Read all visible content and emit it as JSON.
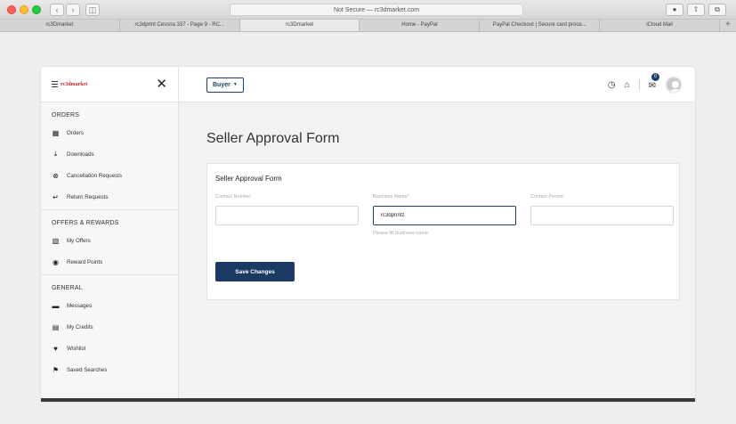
{
  "browser": {
    "address": "Not Secure — rc3dmarket.com",
    "tabs": [
      "rc3Dmarket",
      "rc3dprint Cessna 337 - Page 9 - RC...",
      "rc3Dmarket",
      "Home - PayPal",
      "PayPal Checkout | Secure card proce...",
      "iCloud Mail"
    ],
    "active_tab": 2
  },
  "sidebar": {
    "logo_text": "rc3dmarket",
    "sections": [
      {
        "title": "ORDERS",
        "items": [
          {
            "label": "Orders",
            "icon": "orders-icon"
          },
          {
            "label": "Downloads",
            "icon": "download-icon"
          },
          {
            "label": "Cancellation Requests",
            "icon": "cancel-circle-icon"
          },
          {
            "label": "Return Requests",
            "icon": "return-arrow-icon"
          }
        ]
      },
      {
        "title": "OFFERS & REWARDS",
        "items": [
          {
            "label": "My Offers",
            "icon": "offer-tag-icon"
          },
          {
            "label": "Reward Points",
            "icon": "medal-icon"
          }
        ]
      },
      {
        "title": "GENERAL",
        "items": [
          {
            "label": "Messages",
            "icon": "message-icon"
          },
          {
            "label": "My Credits",
            "icon": "credit-card-icon"
          },
          {
            "label": "Wishlist",
            "icon": "heart-icon"
          },
          {
            "label": "Saved Searches",
            "icon": "bookmark-icon"
          }
        ]
      }
    ]
  },
  "header": {
    "role_label": "Buyer",
    "message_count": "0"
  },
  "main": {
    "page_title": "Seller Approval Form",
    "card_title": "Seller Approval Form",
    "fields": {
      "contact_number": {
        "label": "Contact Number",
        "value": ""
      },
      "business_name": {
        "label": "Business Name*",
        "value": "rc3dprintz",
        "helper": "Please fill business name"
      },
      "contact_person": {
        "label": "Contact Person",
        "value": ""
      }
    },
    "save_label": "Save Changes"
  }
}
